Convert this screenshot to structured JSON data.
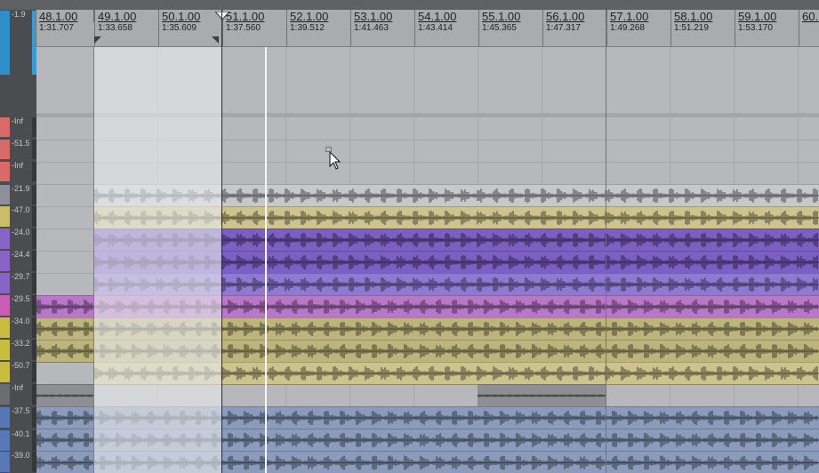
{
  "ruler": {
    "marks": [
      {
        "bar": "48.1.00",
        "time": "1:31.707"
      },
      {
        "bar": "49.1.00",
        "time": "1:33.658"
      },
      {
        "bar": "50.1.00",
        "time": "1:35.609"
      },
      {
        "bar": "51.1.00",
        "time": "1:37.560"
      },
      {
        "bar": "52.1.00",
        "time": "1:39.512"
      },
      {
        "bar": "53.1.00",
        "time": "1:41.463"
      },
      {
        "bar": "54.1.00",
        "time": "1:43.414"
      },
      {
        "bar": "55.1.00",
        "time": "1:45.365"
      },
      {
        "bar": "56.1.00",
        "time": "1:47.317"
      },
      {
        "bar": "57.1.00",
        "time": "1:49.268"
      },
      {
        "bar": "58.1.00",
        "time": "1:51.219"
      },
      {
        "bar": "59.1.00",
        "time": "1:53.170"
      },
      {
        "bar": "60.1.00",
        "time": ""
      }
    ]
  },
  "meters": [
    {
      "label": "-1.9",
      "color": "#2f8dc7"
    },
    {
      "label": "-Inf",
      "color": "#d96a6a"
    },
    {
      "label": "-51.5",
      "color": "#d96a6a"
    },
    {
      "label": "-Inf",
      "color": "#d96a6a"
    },
    {
      "label": "-21.9",
      "color": "#8e9099"
    },
    {
      "label": "-47.0",
      "color": "#c9bd6a"
    },
    {
      "label": "-24.0",
      "color": "#8a63c8"
    },
    {
      "label": "-24.4",
      "color": "#8a63c8"
    },
    {
      "label": "-29.7",
      "color": "#8a63c8"
    },
    {
      "label": "-29.5",
      "color": "#c85fb4"
    },
    {
      "label": "-34.0",
      "color": "#c9bd3f"
    },
    {
      "label": "-33.2",
      "color": "#c9bd3f"
    },
    {
      "label": "-50.7",
      "color": "#c9bd3f"
    },
    {
      "label": "-Inf",
      "color": "#6a6c70"
    },
    {
      "label": "-37.5",
      "color": "#5877b5"
    },
    {
      "label": "-40.1",
      "color": "#5877b5"
    },
    {
      "label": "-39.0",
      "color": "#5877b5"
    }
  ],
  "colors": {
    "ghost": "#c7c8cb",
    "khaki": "#cdc38d",
    "purple": "#7c5fc2",
    "lavender": "#8f7ad3",
    "magenta": "#b977c8",
    "olive": "#bdb47b",
    "steel": "#8a9bbb",
    "grey": "#8d8f93",
    "playhead": "#3b9a3b",
    "marker": "#d23a3a"
  },
  "icons": {
    "pointer": "pointer-cursor-icon",
    "loop_start": "loop-start-flag-icon",
    "loop_end": "loop-end-flag-icon",
    "insert": "insert-marker-icon"
  }
}
